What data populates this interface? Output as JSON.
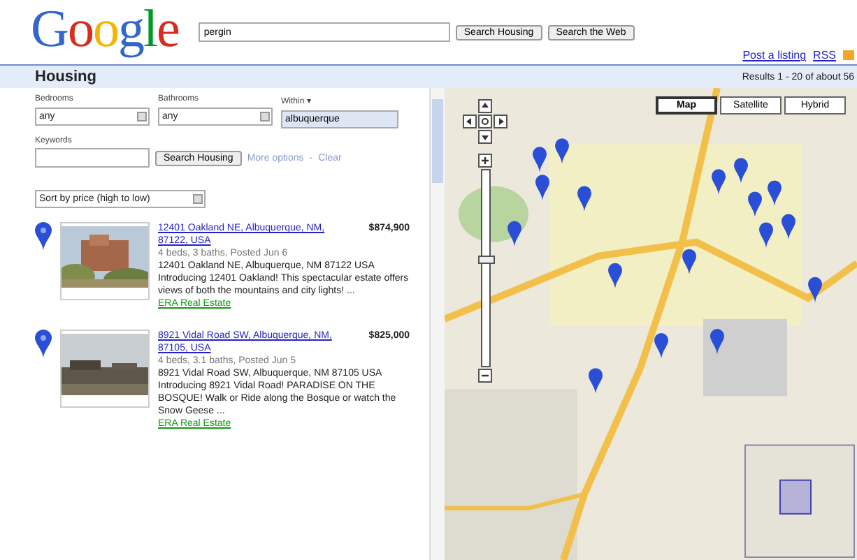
{
  "logo": "Google",
  "search": {
    "value": "pergin",
    "buttons": [
      "Search Housing",
      "Search the Web"
    ]
  },
  "header_links": [
    "Post a listing",
    "RSS"
  ],
  "section": {
    "title": "Housing",
    "results": "Results 1 - 20 of about 56"
  },
  "filters": [
    {
      "label": "Bedrooms",
      "kind": "select",
      "value": "any"
    },
    {
      "label": "Bathrooms",
      "kind": "select",
      "value": "any"
    },
    {
      "label": "Within ▾",
      "kind": "text",
      "value": "albuquerque"
    }
  ],
  "keywords": {
    "label": "Keywords",
    "button": "Search Housing",
    "links": [
      "More options",
      "Clear"
    ],
    "separator": "-"
  },
  "sort": {
    "value": "Sort by price (high to low)"
  },
  "listings": [
    {
      "title": "12401 Oakland NE, Albuquerque, NM, 87122, USA",
      "price": "$874,900",
      "meta": "4 beds, 3 baths, Posted Jun 6",
      "description": "12401 Oakland NE, Albuquerque, NM 87122 USA Introducing 12401 Oakland! This spectacular estate offers views of both the mountains and city lights! ...",
      "source": "ERA Real Estate"
    },
    {
      "title": "8921 Vidal Road SW, Albuquerque, NM, 87105, USA",
      "price": "$825,000",
      "meta": "4 beds, 3.1 baths, Posted Jun 5",
      "description": "8921 Vidal Road SW, Albuquerque, NM 87105 USA Introducing 8921 Vidal Road! PARADISE ON THE BOSQUE! Walk or Ride along the Bosque or watch the Snow Geese ...",
      "source": "ERA Real Estate"
    }
  ],
  "map": {
    "zoom": {
      "level": 0.55
    },
    "types": [
      {
        "label": "Map",
        "selected": true
      },
      {
        "label": "Satellite",
        "selected": false
      },
      {
        "label": "Hybrid",
        "selected": false
      }
    ]
  }
}
